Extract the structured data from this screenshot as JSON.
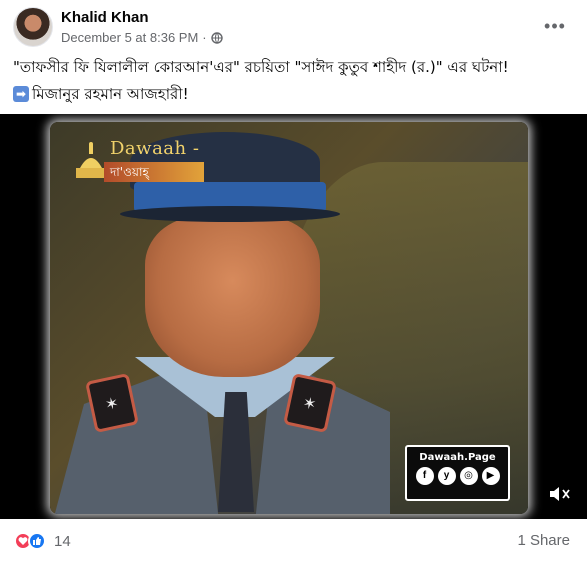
{
  "post": {
    "author": "Khalid Khan",
    "timestamp": "December 5 at 8:36 PM",
    "separator": "·",
    "more_icon": "more-horizontal-icon",
    "text_line1": "\"তাফসীর ফি যিলালীল কোরআন'এর\" রচয়িতা \"সাঈদ কুতুব শাহীদ (র.)\" এর ঘটনা!",
    "text_line2": "মিজানুর রহমান আজহারী!"
  },
  "video": {
    "logo_word": "Dawaah -",
    "logo_band": "দা'ওয়াহ্",
    "page_name": "Dawaah.Page",
    "socials": [
      "f",
      "y",
      "◎",
      "▶"
    ]
  },
  "footer": {
    "reaction_count": "14",
    "shares": "1 Share"
  }
}
